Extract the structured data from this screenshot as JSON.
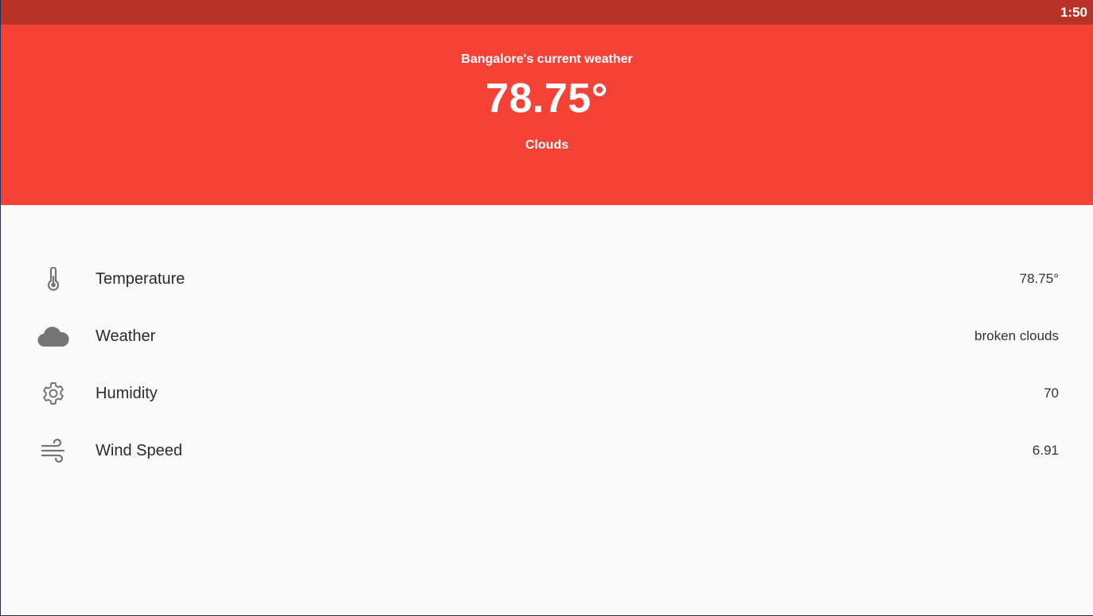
{
  "status_bar": {
    "time": "1:50"
  },
  "header": {
    "title": "Bangalore's current weather",
    "temperature": "78.75°",
    "description": "Clouds"
  },
  "details": [
    {
      "icon": "thermometer-icon",
      "label": "Temperature",
      "value": "78.75°"
    },
    {
      "icon": "cloud-icon",
      "label": "Weather",
      "value": "broken clouds"
    },
    {
      "icon": "gear-icon",
      "label": "Humidity",
      "value": "70"
    },
    {
      "icon": "wind-icon",
      "label": "Wind Speed",
      "value": "6.91"
    }
  ],
  "colors": {
    "status_bar": "#b83227",
    "header": "#f44336",
    "background": "#fafafa",
    "icon": "#757575"
  }
}
